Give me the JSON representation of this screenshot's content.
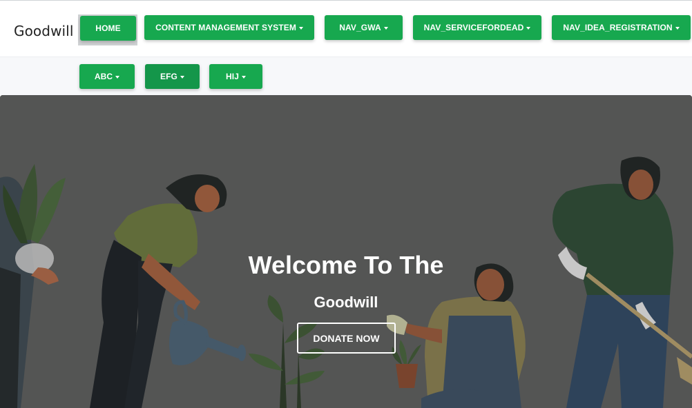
{
  "brand": "Goodwill",
  "nav": {
    "home": "HOME",
    "cms": "CONTENT MANAGEMENT SYSTEM",
    "gwa": "NAV_GWA",
    "servicefordead": "NAV_SERVICEFORDEAD",
    "idea_registration": "NAV_IDEA_REGISTRATION",
    "abc": "ABC",
    "efg": "EFG",
    "hij": "HIJ"
  },
  "hero": {
    "title": "Welcome To The",
    "subtitle": "Goodwill",
    "donate_label": "DONATE NOW"
  },
  "colors": {
    "accent": "#17a84f",
    "hero_bg": "#5c5d5c"
  }
}
